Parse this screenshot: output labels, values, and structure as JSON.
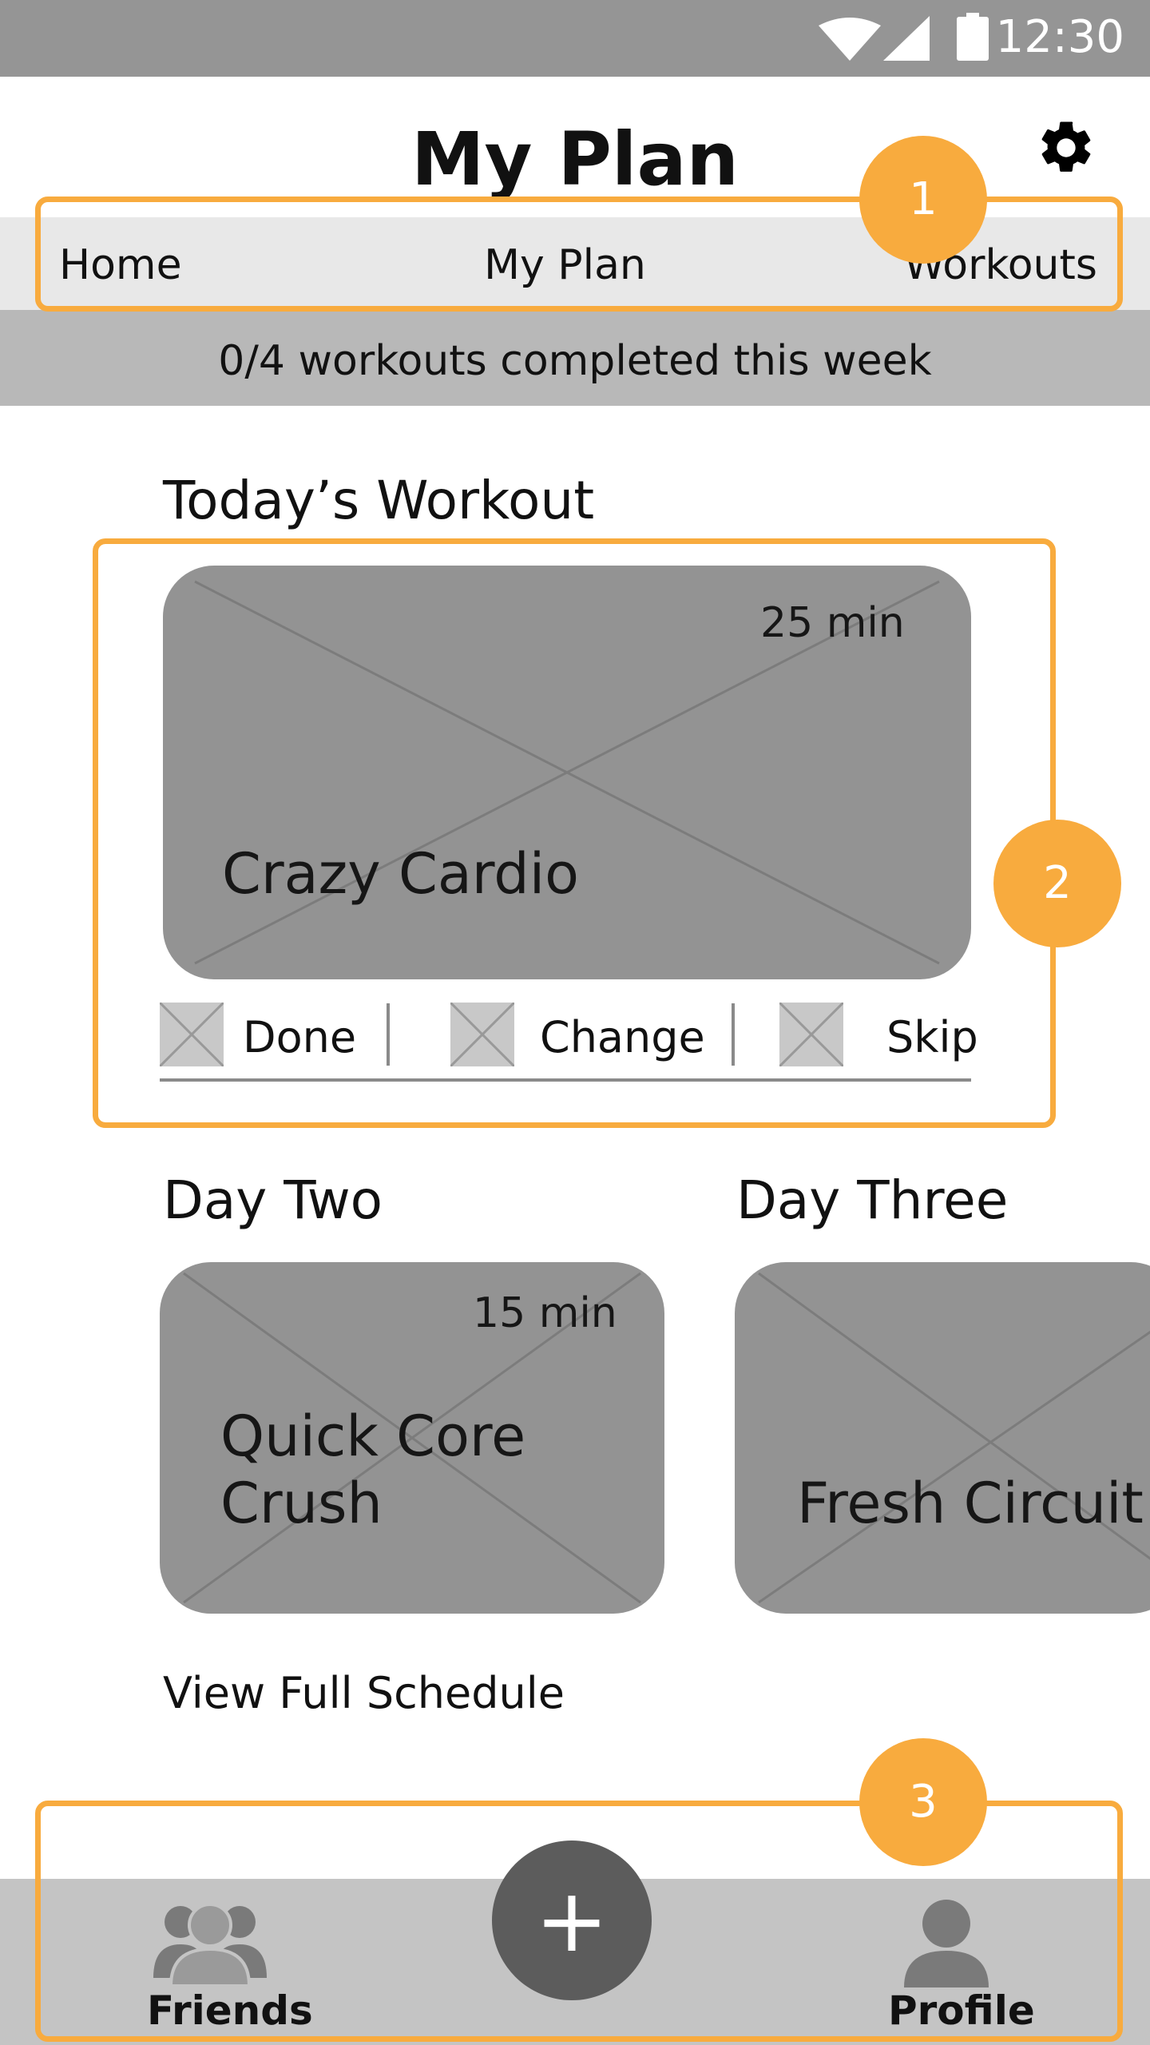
{
  "status_bar": {
    "time": "12:30"
  },
  "header": {
    "title": "My Plan"
  },
  "tabs": [
    {
      "label": "Home"
    },
    {
      "label": "My Plan"
    },
    {
      "label": "Workouts"
    }
  ],
  "progress": {
    "text": "0/4 workouts completed this week",
    "completed": 0,
    "total": 4
  },
  "today": {
    "heading": "Today’s Workout",
    "card": {
      "title": "Crazy Cardio",
      "duration": "25 min"
    },
    "actions": [
      {
        "label": "Done"
      },
      {
        "label": "Change"
      },
      {
        "label": "Skip"
      }
    ]
  },
  "upcoming": [
    {
      "heading": "Day Two",
      "title_line1": "Quick Core",
      "title_line2": "Crush",
      "duration": "15 min"
    },
    {
      "heading": "Day Three",
      "title_line1": "Fresh Circuit"
    }
  ],
  "schedule_link": "View Full Schedule",
  "bottom_nav": {
    "friends": "Friends",
    "add": "+",
    "profile": "Profile"
  },
  "callouts": [
    "1",
    "2",
    "3"
  ],
  "colors": {
    "callout": "#f8ab3e",
    "placeholder": "#939393",
    "fab": "#5c5c5c"
  }
}
